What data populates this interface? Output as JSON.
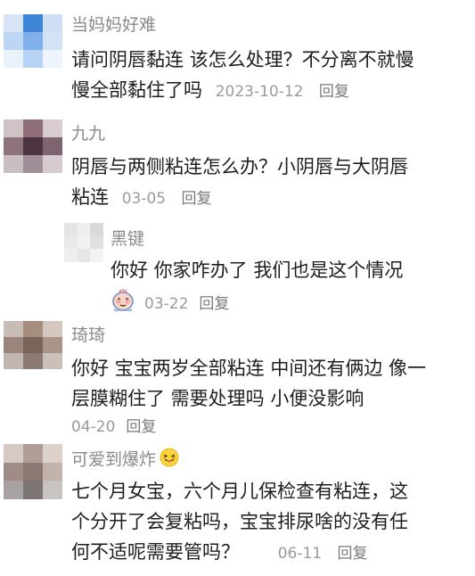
{
  "comments": [
    {
      "name": "当妈妈好难",
      "line1": "请问阴唇黏连 该怎么处理？不分离不就慢",
      "line2": "慢全部黏住了吗",
      "date": "2023-10-12",
      "reply": "回复",
      "avatar_colors": [
        "#d6e4f5",
        "#3f86d9",
        "#cfe0f6",
        "#bcd6f4",
        "#7fb0ea",
        "#d3e3f6",
        "#e9f1fb",
        "#b7d2f2",
        "#eef4fb"
      ]
    },
    {
      "name": "九九",
      "line1": "阴唇与两侧粘连怎么办？小阴唇与大阴唇",
      "line2": "粘连",
      "date": "03-05",
      "reply": "回复",
      "avatar_colors": [
        "#cfc3c6",
        "#8d6e79",
        "#d8ccce",
        "#8e727c",
        "#4b3340",
        "#7e6471",
        "#c9bfc3",
        "#a08e98",
        "#d6ccd0"
      ]
    },
    {
      "name": "黑键",
      "line1": "你好 你家咋办了  我们也是这个情况",
      "date": "03-22",
      "reply": "回复",
      "avatar_colors": [
        "#e6e4e2",
        "#f1efed",
        "#dcdad8",
        "#eceae8",
        "#f3f1ef",
        "#e2e0de",
        "#efedeb",
        "#e8e6e4",
        "#f5f3f1"
      ]
    },
    {
      "name": "琦琦",
      "line1": "你好 宝宝两岁全部粘连 中间还有俩边 像一",
      "line2": "层膜糊住了 需要处理吗 小便没影响",
      "date": "04-20",
      "reply": "回复",
      "avatar_colors": [
        "#c8bcb6",
        "#a58e80",
        "#d4c7bf",
        "#9a857a",
        "#7a6458",
        "#a99488",
        "#c2b6b0",
        "#8c7b72",
        "#cbbfb9"
      ]
    },
    {
      "name": "可爱到爆炸",
      "line1": "七个月女宝，六个月儿保检查有粘连，这",
      "line2": "个分开了会复粘吗，宝宝排尿啥的没有任",
      "line3": "何不适呢需要管吗？",
      "date": "06-11",
      "reply": "回复",
      "avatar_colors": [
        "#d6c9c4",
        "#b09d96",
        "#ddd1cc",
        "#a08c86",
        "#8c7872",
        "#c2b2ac",
        "#a8a3a2",
        "#7d7574",
        "#c9c3c2"
      ]
    }
  ],
  "icons": {
    "sticker": "blushing-face-sticker-icon",
    "emoji": "squinting-tongue-face-emoji-icon"
  }
}
